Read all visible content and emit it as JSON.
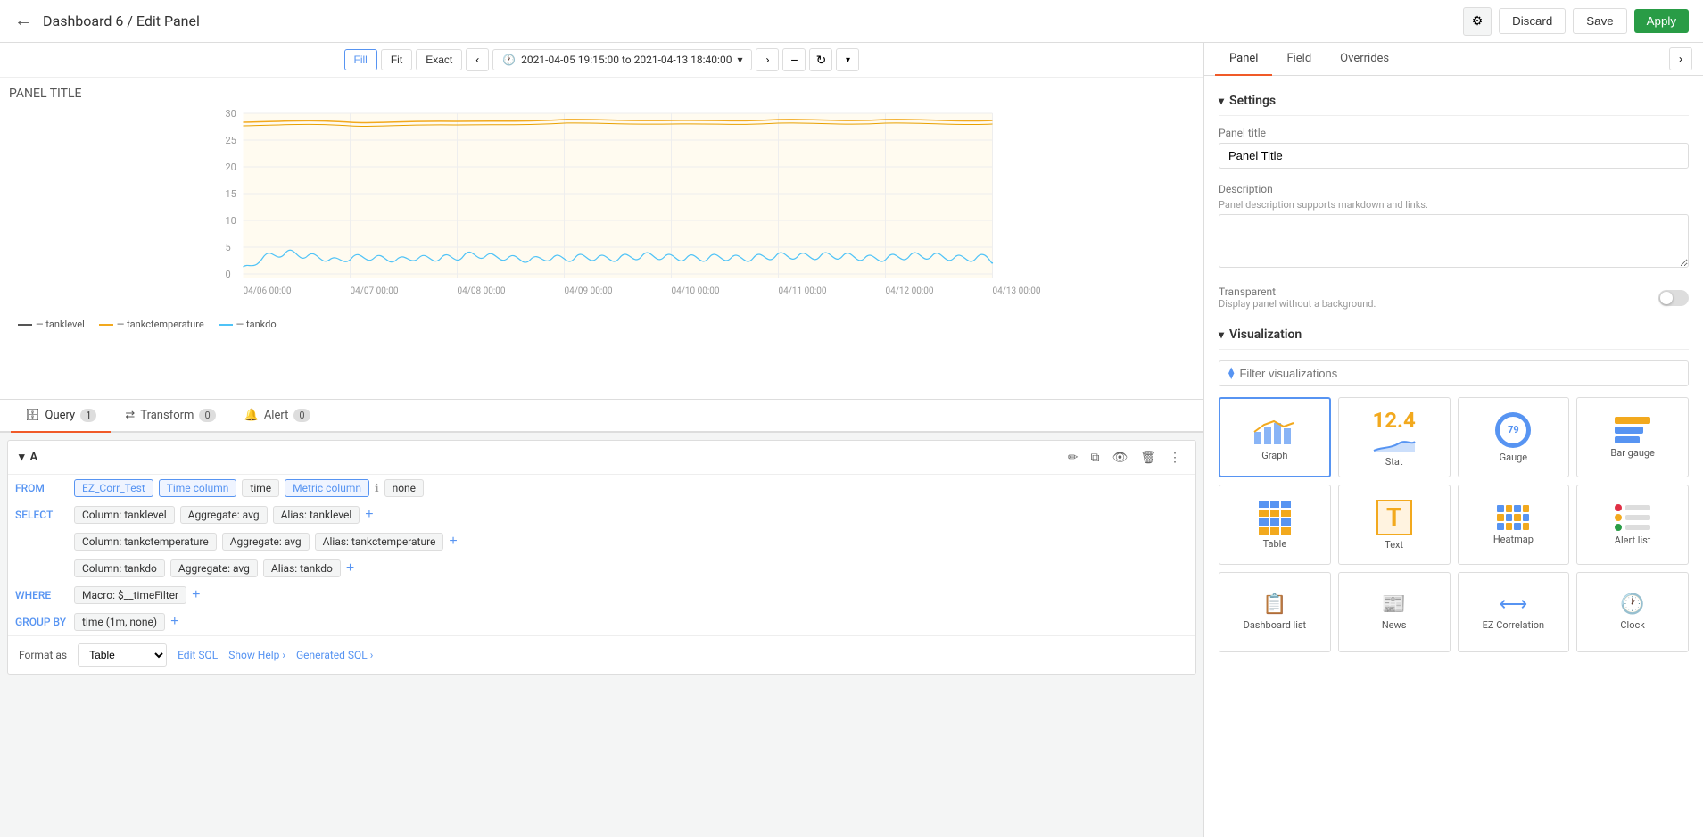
{
  "header": {
    "back_label": "←",
    "title": "Dashboard 6 / Edit Panel",
    "gear_icon": "⚙",
    "discard_label": "Discard",
    "save_label": "Save",
    "apply_label": "Apply"
  },
  "chart_toolbar": {
    "fill_label": "Fill",
    "fit_label": "Fit",
    "exact_label": "Exact",
    "prev_icon": "‹",
    "time_icon": "🕐",
    "time_range": "2021-04-05 19:15:00 to 2021-04-13 18:40:00",
    "next_icon": "›",
    "zoom_out_icon": "−",
    "refresh_icon": "↻",
    "more_icon": "▾"
  },
  "chart": {
    "panel_title": "PANEL TITLE",
    "y_labels": [
      "30",
      "25",
      "20",
      "15",
      "10",
      "5",
      "0"
    ],
    "x_labels": [
      "04/06 00:00",
      "04/07 00:00",
      "04/08 00:00",
      "04/09 00:00",
      "04/10 00:00",
      "04/11 00:00",
      "04/12 00:00",
      "04/13 00:00"
    ],
    "legend": [
      {
        "name": "tanklevel",
        "color": "#f2a91e"
      },
      {
        "name": "tankctemperature",
        "color": "#f2a91e"
      },
      {
        "name": "tankdo",
        "color": "#4fc3f7"
      }
    ]
  },
  "query_tabs": [
    {
      "label": "Query",
      "badge": "1",
      "icon": "🗄"
    },
    {
      "label": "Transform",
      "badge": "0",
      "icon": "⇄"
    },
    {
      "label": "Alert",
      "badge": "0",
      "icon": "🔔"
    }
  ],
  "query_section": {
    "title": "A",
    "edit_icon": "✏",
    "copy_icon": "⧉",
    "eye_icon": "👁",
    "delete_icon": "🗑",
    "more_icon": "⋮",
    "from_label": "FROM",
    "from_table": "EZ_Corr_Test",
    "time_column_label": "Time column",
    "time_column_value": "time",
    "metric_column_label": "Metric column",
    "metric_column_value": "none",
    "select_label": "SELECT",
    "columns": [
      {
        "col": "Column: tanklevel",
        "agg": "Aggregate: avg",
        "alias": "Alias: tanklevel"
      },
      {
        "col": "Column: tankctemperature",
        "agg": "Aggregate: avg",
        "alias": "Alias: tankctemperature"
      },
      {
        "col": "Column: tankdo",
        "agg": "Aggregate: avg",
        "alias": "Alias: tankdo"
      }
    ],
    "where_label": "WHERE",
    "where_value": "Macro: $__timeFilter",
    "group_by_label": "GROUP BY",
    "group_by_value": "time (1m, none)",
    "format_label": "Format as",
    "format_value": "Table",
    "edit_sql_label": "Edit SQL",
    "show_help_label": "Show Help",
    "show_help_arrow": "›",
    "generated_sql_label": "Generated SQL",
    "generated_sql_arrow": "›"
  },
  "right_panel": {
    "tabs": [
      "Panel",
      "Field",
      "Overrides"
    ],
    "expand_icon": "›",
    "settings_title": "Settings",
    "panel_title_label": "Panel title",
    "panel_title_value": "Panel Title",
    "description_label": "Description",
    "description_hint": "Panel description supports markdown and links.",
    "transparent_label": "Transparent",
    "transparent_hint": "Display panel without a background.",
    "visualization_title": "Visualization",
    "filter_placeholder": "Filter visualizations",
    "visualizations": [
      {
        "name": "Graph",
        "type": "graph"
      },
      {
        "name": "Stat",
        "type": "stat",
        "value": "12.4"
      },
      {
        "name": "Gauge",
        "type": "gauge",
        "value": "79"
      },
      {
        "name": "Bar gauge",
        "type": "bar-gauge"
      },
      {
        "name": "Table",
        "type": "table"
      },
      {
        "name": "Text",
        "type": "text"
      },
      {
        "name": "Heatmap",
        "type": "heatmap"
      },
      {
        "name": "Alert list",
        "type": "alert-list"
      },
      {
        "name": "Dashboard list",
        "type": "dashboard-list"
      },
      {
        "name": "News",
        "type": "news"
      },
      {
        "name": "EZ Correlation",
        "type": "ez-correlation"
      },
      {
        "name": "Clock",
        "type": "clock"
      }
    ]
  }
}
